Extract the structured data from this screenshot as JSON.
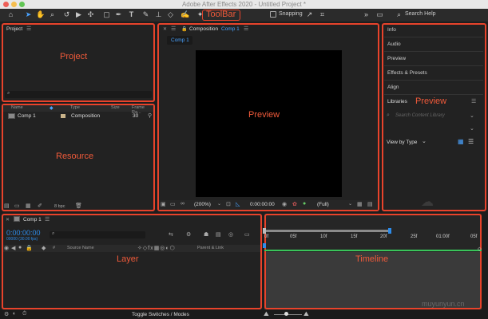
{
  "window": {
    "title": "Adobe After Effects 2020 - Untitled Project *"
  },
  "colors": {
    "annotation": "#e8432b",
    "accent_blue": "#2d8ceb",
    "timecode_blue": "#2d8ceb",
    "work_area_green": "#39c45a"
  },
  "toolbar": {
    "annotation_label": "ToolBar",
    "snapping_label": "Snapping",
    "search_placeholder": "Search Help",
    "tools": [
      "home-icon",
      "selection-icon",
      "hand-icon",
      "zoom-icon",
      "rotate-icon",
      "camera-icon",
      "pan-behind-icon",
      "rectangle-icon",
      "pen-icon",
      "text-icon",
      "brush-icon",
      "clone-stamp-icon",
      "eraser-icon",
      "roto-brush-icon",
      "puppet-pin-icon"
    ]
  },
  "project_panel": {
    "tab_label": "Project",
    "annotation_label": "Project"
  },
  "resource_panel": {
    "annotation_label": "Resource",
    "columns": {
      "name": "Name",
      "type": "Type",
      "size": "Size",
      "frame_rate": "Frame Ra..."
    },
    "rows": [
      {
        "name": "Comp 1",
        "type": "Composition",
        "frame_rate": "30"
      }
    ],
    "bpc": "8 bpc"
  },
  "preview_panel": {
    "tab_prefix": "Composition",
    "tab_comp": "Comp 1",
    "subtab": "Comp 1",
    "annotation_label": "Preview",
    "zoom": "(200%)",
    "timecode": "0:00:00:00",
    "resolution": "(Full)"
  },
  "right_panel": {
    "items": [
      "Info",
      "Audio",
      "Preview",
      "Effects & Presets",
      "Align"
    ],
    "libraries_tab": "Libraries",
    "annotation_label": "Preview",
    "search_placeholder": "Search Content Library",
    "view_by": "View by Type"
  },
  "layer_panel": {
    "tab_label": "Comp 1",
    "timecode": "0:00:00:00",
    "fps": "00000 (30.00 fps)",
    "search_placeholder": "",
    "columns": {
      "source_name": "Source Name",
      "parent_link": "Parent & Link"
    },
    "annotation_label": "Layer"
  },
  "timeline": {
    "annotation_label": "Timeline",
    "ticks": [
      "0f",
      "05f",
      "10f",
      "15f",
      "20f",
      "25f",
      "01:00f",
      "05f"
    ]
  },
  "status_bar": {
    "toggle_label": "Toggle Switches / Modes"
  },
  "watermark": "muyunyun.cn"
}
